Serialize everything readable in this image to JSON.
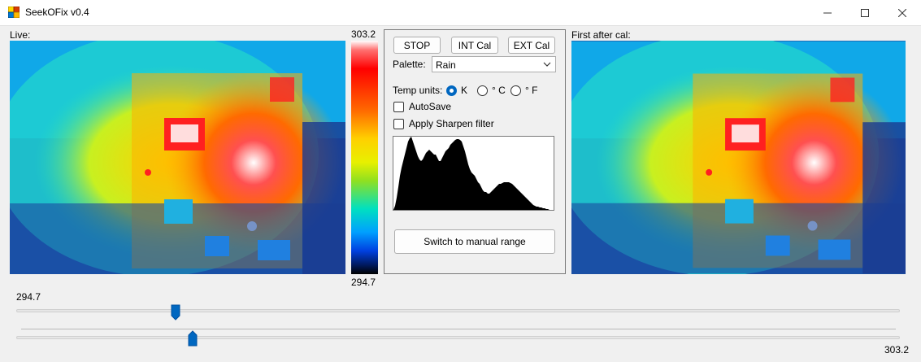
{
  "window": {
    "title": "SeekOFix v0.4"
  },
  "live_label": "Live:",
  "first_label": "First after cal:",
  "colorbar": {
    "max_label": "303.2",
    "min_label": "294.7"
  },
  "controls": {
    "stop_label": "STOP",
    "int_cal_label": "INT Cal",
    "ext_cal_label": "EXT Cal",
    "palette_label": "Palette:",
    "palette_value": "Rain",
    "temp_units_label": "Temp units:",
    "unit_k": "K",
    "unit_c": "° C",
    "unit_f": "° F",
    "selected_unit": "K",
    "autosave_label": "AutoSave",
    "autosave_checked": false,
    "sharpen_label": "Apply Sharpen filter",
    "sharpen_checked": false,
    "manual_range_label": "Switch to manual range"
  },
  "sliders": {
    "min_value_label": "294.7",
    "max_value_label": "303.2",
    "min_position": 0.18,
    "max_position": 0.2
  },
  "colors": {
    "accent": "#0067c0"
  }
}
